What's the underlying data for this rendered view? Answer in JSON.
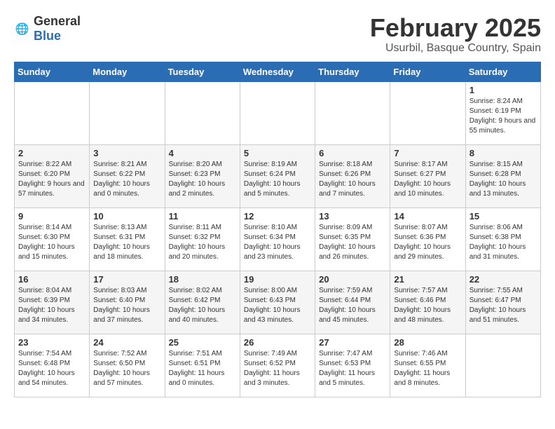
{
  "header": {
    "logo_general": "General",
    "logo_blue": "Blue",
    "month_title": "February 2025",
    "location": "Usurbil, Basque Country, Spain"
  },
  "weekdays": [
    "Sunday",
    "Monday",
    "Tuesday",
    "Wednesday",
    "Thursday",
    "Friday",
    "Saturday"
  ],
  "weeks": [
    [
      {
        "day": "",
        "info": ""
      },
      {
        "day": "",
        "info": ""
      },
      {
        "day": "",
        "info": ""
      },
      {
        "day": "",
        "info": ""
      },
      {
        "day": "",
        "info": ""
      },
      {
        "day": "",
        "info": ""
      },
      {
        "day": "1",
        "info": "Sunrise: 8:24 AM\nSunset: 6:19 PM\nDaylight: 9 hours and 55 minutes."
      }
    ],
    [
      {
        "day": "2",
        "info": "Sunrise: 8:22 AM\nSunset: 6:20 PM\nDaylight: 9 hours and 57 minutes."
      },
      {
        "day": "3",
        "info": "Sunrise: 8:21 AM\nSunset: 6:22 PM\nDaylight: 10 hours and 0 minutes."
      },
      {
        "day": "4",
        "info": "Sunrise: 8:20 AM\nSunset: 6:23 PM\nDaylight: 10 hours and 2 minutes."
      },
      {
        "day": "5",
        "info": "Sunrise: 8:19 AM\nSunset: 6:24 PM\nDaylight: 10 hours and 5 minutes."
      },
      {
        "day": "6",
        "info": "Sunrise: 8:18 AM\nSunset: 6:26 PM\nDaylight: 10 hours and 7 minutes."
      },
      {
        "day": "7",
        "info": "Sunrise: 8:17 AM\nSunset: 6:27 PM\nDaylight: 10 hours and 10 minutes."
      },
      {
        "day": "8",
        "info": "Sunrise: 8:15 AM\nSunset: 6:28 PM\nDaylight: 10 hours and 13 minutes."
      }
    ],
    [
      {
        "day": "9",
        "info": "Sunrise: 8:14 AM\nSunset: 6:30 PM\nDaylight: 10 hours and 15 minutes."
      },
      {
        "day": "10",
        "info": "Sunrise: 8:13 AM\nSunset: 6:31 PM\nDaylight: 10 hours and 18 minutes."
      },
      {
        "day": "11",
        "info": "Sunrise: 8:11 AM\nSunset: 6:32 PM\nDaylight: 10 hours and 20 minutes."
      },
      {
        "day": "12",
        "info": "Sunrise: 8:10 AM\nSunset: 6:34 PM\nDaylight: 10 hours and 23 minutes."
      },
      {
        "day": "13",
        "info": "Sunrise: 8:09 AM\nSunset: 6:35 PM\nDaylight: 10 hours and 26 minutes."
      },
      {
        "day": "14",
        "info": "Sunrise: 8:07 AM\nSunset: 6:36 PM\nDaylight: 10 hours and 29 minutes."
      },
      {
        "day": "15",
        "info": "Sunrise: 8:06 AM\nSunset: 6:38 PM\nDaylight: 10 hours and 31 minutes."
      }
    ],
    [
      {
        "day": "16",
        "info": "Sunrise: 8:04 AM\nSunset: 6:39 PM\nDaylight: 10 hours and 34 minutes."
      },
      {
        "day": "17",
        "info": "Sunrise: 8:03 AM\nSunset: 6:40 PM\nDaylight: 10 hours and 37 minutes."
      },
      {
        "day": "18",
        "info": "Sunrise: 8:02 AM\nSunset: 6:42 PM\nDaylight: 10 hours and 40 minutes."
      },
      {
        "day": "19",
        "info": "Sunrise: 8:00 AM\nSunset: 6:43 PM\nDaylight: 10 hours and 43 minutes."
      },
      {
        "day": "20",
        "info": "Sunrise: 7:59 AM\nSunset: 6:44 PM\nDaylight: 10 hours and 45 minutes."
      },
      {
        "day": "21",
        "info": "Sunrise: 7:57 AM\nSunset: 6:46 PM\nDaylight: 10 hours and 48 minutes."
      },
      {
        "day": "22",
        "info": "Sunrise: 7:55 AM\nSunset: 6:47 PM\nDaylight: 10 hours and 51 minutes."
      }
    ],
    [
      {
        "day": "23",
        "info": "Sunrise: 7:54 AM\nSunset: 6:48 PM\nDaylight: 10 hours and 54 minutes."
      },
      {
        "day": "24",
        "info": "Sunrise: 7:52 AM\nSunset: 6:50 PM\nDaylight: 10 hours and 57 minutes."
      },
      {
        "day": "25",
        "info": "Sunrise: 7:51 AM\nSunset: 6:51 PM\nDaylight: 11 hours and 0 minutes."
      },
      {
        "day": "26",
        "info": "Sunrise: 7:49 AM\nSunset: 6:52 PM\nDaylight: 11 hours and 3 minutes."
      },
      {
        "day": "27",
        "info": "Sunrise: 7:47 AM\nSunset: 6:53 PM\nDaylight: 11 hours and 5 minutes."
      },
      {
        "day": "28",
        "info": "Sunrise: 7:46 AM\nSunset: 6:55 PM\nDaylight: 11 hours and 8 minutes."
      },
      {
        "day": "",
        "info": ""
      }
    ]
  ]
}
